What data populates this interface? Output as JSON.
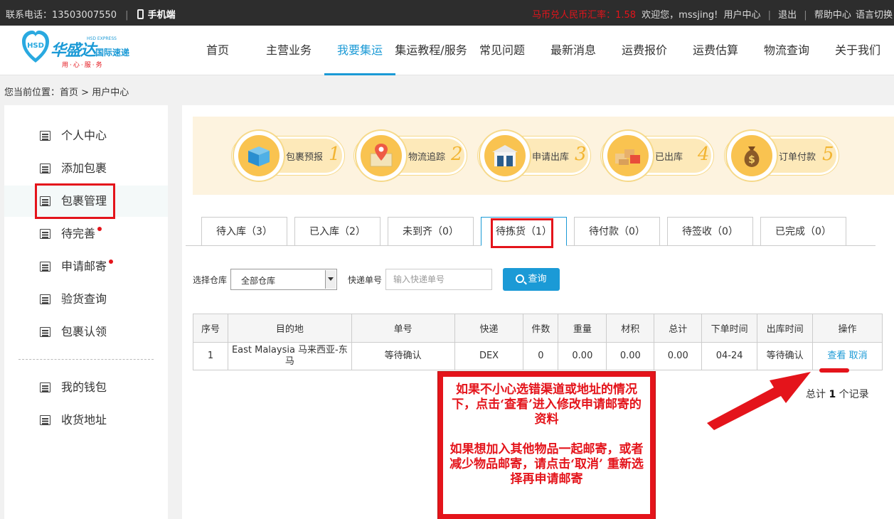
{
  "topbar": {
    "phone": "联系电话：13503007550",
    "mobile": "手机端",
    "rate": "马币兑人民币汇率：1.58",
    "welcome": "欢迎您，mssjing!",
    "user_center": "用户中心",
    "logout": "退出",
    "help": "帮助中心",
    "language": "语言切换"
  },
  "logo": {
    "brand": "华盛达",
    "brand_sub": "国际速递",
    "tag": "HSD EXPRESS",
    "emblem": "HSD",
    "slogan": "用·心·服·务"
  },
  "nav": [
    "首页",
    "主营业务",
    "我要集运",
    "集运教程/服务",
    "常见问题",
    "最新消息",
    "运费报价",
    "运费估算",
    "物流查询",
    "关于我们"
  ],
  "breadcrumb": {
    "prefix": "您当前位置：",
    "home": "首页",
    "sep": ">",
    "current": "用户中心"
  },
  "sidebar": {
    "items": [
      "个人中心",
      "添加包裹",
      "包裹管理",
      "待完善",
      "申请邮寄",
      "验货查询",
      "包裹认领"
    ],
    "items2": [
      "我的钱包",
      "收货地址"
    ]
  },
  "steps": [
    {
      "label": "包裹预报",
      "num": "1",
      "icon": "box-icon"
    },
    {
      "label": "物流追踪",
      "num": "2",
      "icon": "map-pin-icon"
    },
    {
      "label": "申请出库",
      "num": "3",
      "icon": "warehouse-icon"
    },
    {
      "label": "已出库",
      "num": "4",
      "icon": "cargo-icon"
    },
    {
      "label": "订单付款",
      "num": "5",
      "icon": "money-bag-icon"
    }
  ],
  "tabs": [
    "待入库（3）",
    "已入库（2）",
    "未到齐（0）",
    "待拣货（1）",
    "待付款（0）",
    "待签收（0）",
    "已完成（0）"
  ],
  "filter": {
    "warehouse_label": "选择仓库",
    "warehouse_value": "全部仓库",
    "tracking_label": "快递单号",
    "tracking_placeholder": "输入快递单号",
    "query_button": "查询"
  },
  "table": {
    "headers": [
      "序号",
      "目的地",
      "单号",
      "快递",
      "件数",
      "重量",
      "材积",
      "总计",
      "下单时间",
      "出库时间",
      "操作"
    ],
    "rows": [
      {
        "index": "1",
        "destination": "East Malaysia 马来西亚-东马",
        "order_no": "等待确认",
        "courier": "DEX",
        "count": "0",
        "weight": "0.00",
        "volume": "0.00",
        "total": "0.00",
        "order_time": "04-24",
        "out_time": "等待确认",
        "action_view": "查看",
        "action_cancel": "取消"
      }
    ]
  },
  "summary": {
    "prefix": "总计 ",
    "count": "1",
    "suffix": " 个记录"
  },
  "annotation": {
    "para1": "如果不小心选错渠道或地址的情况下，点击‘查看’进入修改申请邮寄的资料",
    "para2": "如果想加入其他物品一起邮寄，或者减少物品邮寄，请点击‘取消’ 重新选择再申请邮寄"
  },
  "colors": {
    "accent": "#1b9ad6",
    "highlight": "#e4141b",
    "step_bg": "#fdf3df"
  }
}
